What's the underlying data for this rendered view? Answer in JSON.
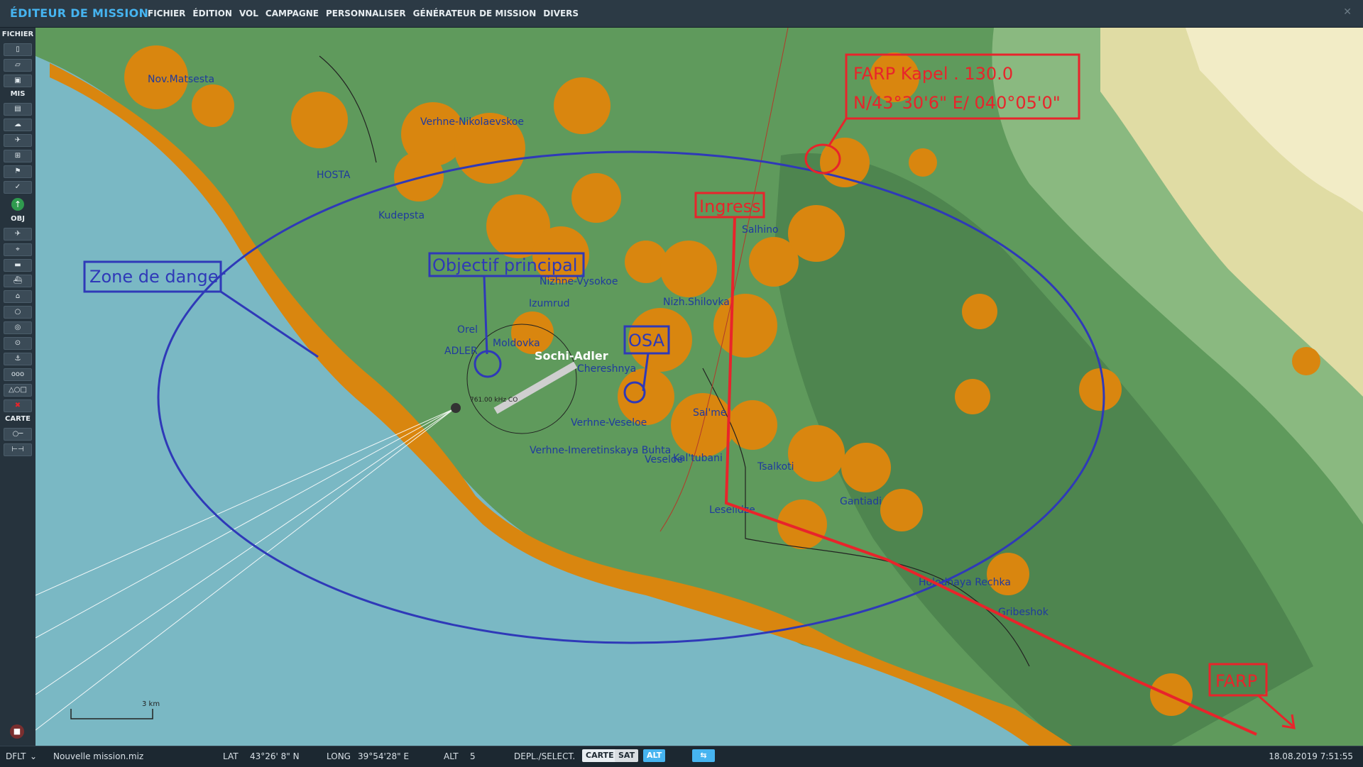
{
  "app_title": "ÉDITEUR DE MISSION",
  "menu": [
    "FICHIER",
    "ÉDITION",
    "VOL",
    "CAMPAGNE",
    "PERSONNALISER",
    "GÉNÉRATEUR DE MISSION",
    "DIVERS"
  ],
  "toolbar": {
    "sections": [
      "FICHIER",
      "MIS",
      "OBJ",
      "CARTE"
    ]
  },
  "map": {
    "towns": [
      "Nov.Matsesta",
      "Verhne-Nikolaevskoe",
      "HOSTA",
      "Kudepsta",
      "Nizhne-Vysokoe",
      "Izumrud",
      "Nizh.Shilovka",
      "Orel",
      "Moldovka",
      "ADLER",
      "Chereshnya",
      "Verhne-Veseloe",
      "Sal'me",
      "Verhne-Imeretinskaya Buhta",
      "Veseloe",
      "Kal'tubani",
      "Tsalkoti",
      "Gantiadi",
      "Leselidze",
      "Salhino",
      "Holodnaya Rechka",
      "Gribeshok"
    ],
    "airbase_name": "Sochi-Adler",
    "frequency_label": "761.00 kHz CO",
    "scale_label": "3 km"
  },
  "annotations": {
    "danger_zone": "Zone de danger",
    "main_objective": "Objectif principal",
    "osa": "OSA",
    "ingress": "Ingress",
    "farp_kapel_line1": "FARP Kapel . 130.0",
    "farp_kapel_line2": "N/43°30'6\"    E/ 040°05'0\"",
    "farp": "FARP"
  },
  "status": {
    "profile": "DFLT",
    "filename": "Nouvelle mission.miz",
    "lat_label": "LAT",
    "lat_value": "43°26' 8\" N",
    "long_label": "LONG",
    "long_value": "39°54'28\" E",
    "alt_label": "ALT",
    "alt_value": "5",
    "mode_label": "DEPL./SELECT.",
    "btn_carte": "CARTE",
    "btn_sat": "SAT",
    "btn_alt": "ALT",
    "datetime": "18.08.2019 7:51:55"
  },
  "colors": {
    "sea": "#7ab8c4",
    "forest": "#5f9a5c",
    "town_area": "#d9860f",
    "annotation_blue": "#2f39b8",
    "annotation_red": "#e8242b",
    "accent": "#46b4f0"
  }
}
